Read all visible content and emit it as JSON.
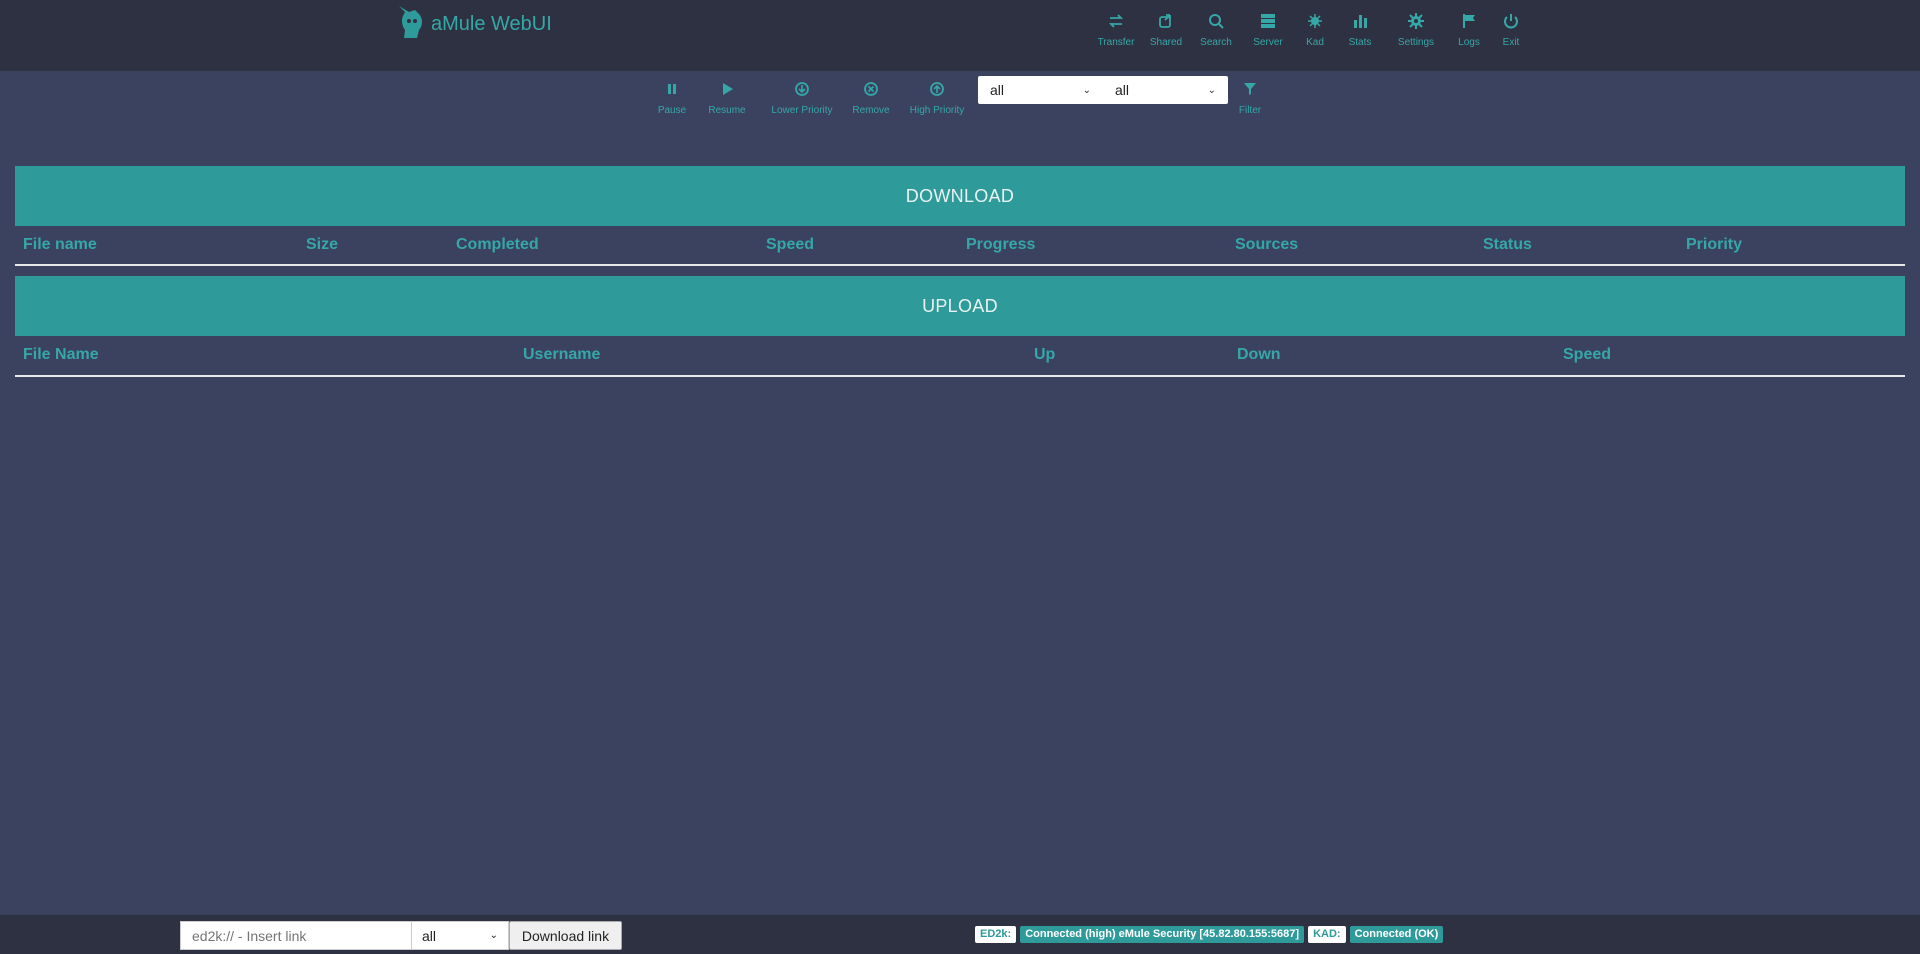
{
  "header": {
    "title": "aMule WebUI",
    "nav": [
      {
        "label": "Transfer",
        "icon": "exchange-icon"
      },
      {
        "label": "Shared",
        "icon": "share-icon"
      },
      {
        "label": "Search",
        "icon": "search-icon"
      },
      {
        "label": "Server",
        "icon": "server-icon"
      },
      {
        "label": "Kad",
        "icon": "kad-icon"
      },
      {
        "label": "Stats",
        "icon": "bar-chart-icon"
      },
      {
        "label": "Settings",
        "icon": "gear-icon"
      },
      {
        "label": "Logs",
        "icon": "flag-icon"
      },
      {
        "label": "Exit",
        "icon": "power-icon"
      }
    ]
  },
  "toolbar": {
    "pause": "Pause",
    "resume": "Resume",
    "lower_priority": "Lower Priority",
    "remove": "Remove",
    "high_priority": "High Priority",
    "filter": "Filter",
    "select1": "all",
    "select2": "all"
  },
  "download": {
    "title": "DOWNLOAD",
    "columns": [
      "File name",
      "Size",
      "Completed",
      "Speed",
      "Progress",
      "Sources",
      "Status",
      "Priority"
    ]
  },
  "upload": {
    "title": "UPLOAD",
    "columns": [
      "File Name",
      "Username",
      "Up",
      "Down",
      "Speed"
    ]
  },
  "footer": {
    "link_placeholder": "ed2k:// - Insert link",
    "category": "all",
    "download_button": "Download link",
    "ed2k_label": "ED2k:",
    "ed2k_status": "Connected (high) eMule Security [45.82.80.155:5687]",
    "kad_label": "KAD:",
    "kad_status": "Connected (OK)"
  },
  "colors": {
    "background": "#3a4260",
    "topbar": "#2e3142",
    "accent": "#2f9a9a"
  }
}
